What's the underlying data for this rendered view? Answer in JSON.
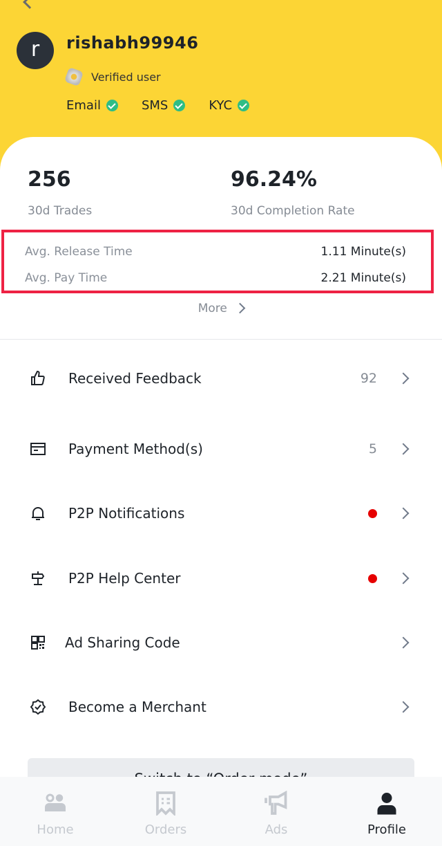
{
  "header": {
    "username": "rishabh99946",
    "avatar_letter": "r",
    "verified": "Verified user",
    "checks": [
      "Email",
      "SMS",
      "KYC"
    ]
  },
  "stats": {
    "trades_value": "256",
    "trades_label": "30d Trades",
    "rate_value": "96.24%",
    "rate_label": "30d Completion Rate"
  },
  "times": [
    {
      "label": "Avg. Release Time",
      "value": "1.11 Minute(s)"
    },
    {
      "label": "Avg. Pay Time",
      "value": "2.21 Minute(s)"
    }
  ],
  "more_label": "More",
  "menu": [
    {
      "label": "Received Feedback",
      "value": "92",
      "icon": "thumbs-up-icon"
    },
    {
      "label": "Payment Method(s)",
      "value": "5",
      "icon": "card-icon"
    },
    {
      "label": "P2P Notifications",
      "dot": true,
      "icon": "bell-icon"
    },
    {
      "label": "P2P Help Center",
      "dot": true,
      "icon": "signpost-icon"
    },
    {
      "label": "Ad Sharing Code",
      "icon": "qr-code-icon"
    },
    {
      "label": "Become a Merchant",
      "icon": "badge-check-icon"
    }
  ],
  "switch_label": "Switch to “Order mode”",
  "nav": [
    {
      "label": "Home"
    },
    {
      "label": "Orders"
    },
    {
      "label": "Ads"
    },
    {
      "label": "Profile",
      "active": true
    }
  ],
  "colors": {
    "brand": "#fcd535",
    "check": "#2ebd85",
    "dot": "#e60000",
    "highlight": "#ee2244"
  }
}
